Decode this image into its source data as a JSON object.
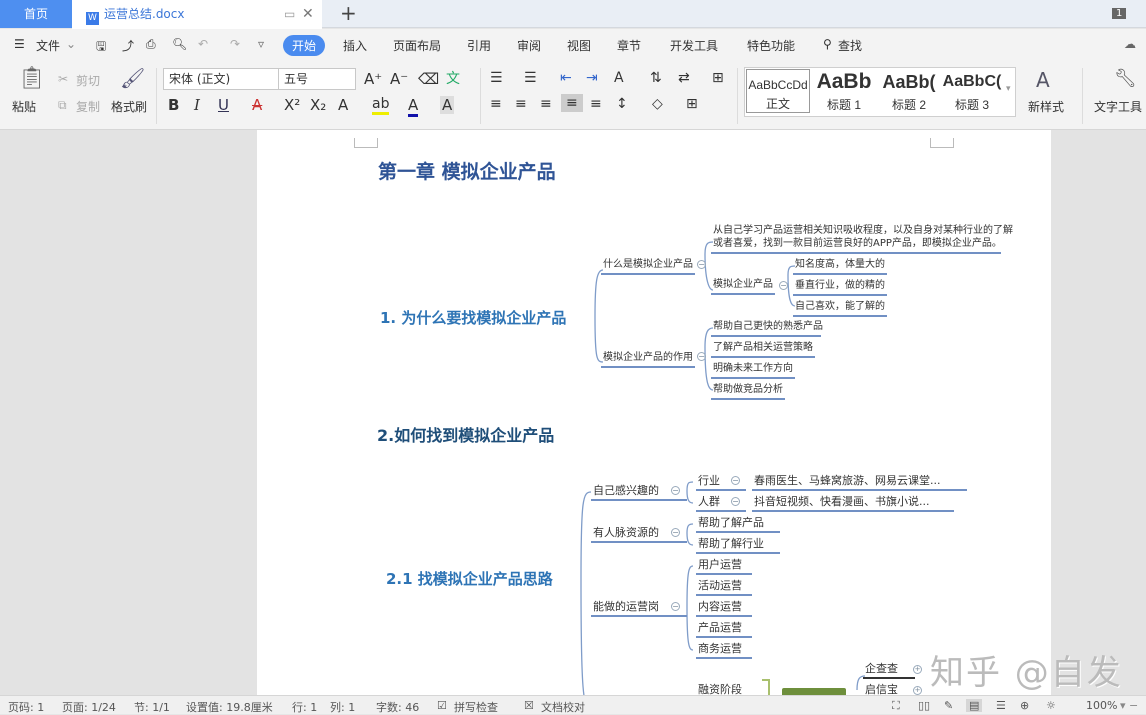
{
  "tabs": {
    "home": "首页",
    "doc": "运营总结.docx",
    "new": "+",
    "badge": "1"
  },
  "menu": {
    "file": "文件",
    "items": [
      "开始",
      "插入",
      "页面布局",
      "引用",
      "审阅",
      "视图",
      "章节",
      "开发工具",
      "特色功能"
    ],
    "search": "查找"
  },
  "toolbar": {
    "paste": "粘贴",
    "cut": "剪切",
    "copy": "复制",
    "format_painter": "格式刷",
    "font": "宋体 (正文)",
    "size": "五号",
    "styles": [
      {
        "preview": "AaBbCcDd",
        "label": "正文"
      },
      {
        "preview": "AaBb",
        "label": "标题 1"
      },
      {
        "preview": "AaBb(",
        "label": "标题 2"
      },
      {
        "preview": "AaBbC(",
        "label": "标题 3"
      }
    ],
    "new_style": "新样式",
    "text_tools": "文字工具"
  },
  "doc": {
    "chapter": "第一章  模拟企业产品",
    "s1": "1. 为什么要找模拟企业产品",
    "m1": {
      "b1": "什么是模拟企业产品",
      "b1_desc1": "从自己学习产品运营相关知识吸收程度，以及自身对某种行业的了解",
      "b1_desc2": "或者喜爱，找到一款目前运营良好的APP产品，即模拟企业产品。",
      "b1_sub": "模拟企业产品",
      "b1_sub_items": [
        "知名度高，体量大的",
        "垂直行业，做的精的",
        "自己喜欢，能了解的"
      ],
      "b2": "模拟企业产品的作用",
      "b2_items": [
        "帮助自己更快的熟悉产品",
        "了解产品相关运营策略",
        "明确未来工作方向",
        "帮助做竞品分析"
      ]
    },
    "s2": "2.如何找到模拟企业产品",
    "s21": "2.1 找模拟企业产品思路",
    "m2": {
      "b1": "自己感兴趣的",
      "b1_items": [
        {
          "k": "行业",
          "v": "春雨医生、马蜂窝旅游、网易云课堂..."
        },
        {
          "k": "人群",
          "v": "抖音短视频、快看漫画、书旗小说..."
        }
      ],
      "b2": "有人脉资源的",
      "b2_items": [
        "帮助了解产品",
        "帮助了解行业"
      ],
      "b3": "能做的运营岗",
      "b3_items": [
        "用户运营",
        "活动运营",
        "内容运营",
        "产品运营",
        "商务运营"
      ],
      "b4_item": "融资阶段",
      "b4_tools": [
        "企查查",
        "启信宝"
      ]
    }
  },
  "watermark": "知乎 @自发",
  "status": {
    "page_num": "页码: 1",
    "pages": "页面: 1/24",
    "section": "节: 1/1",
    "setting": "设置值: 19.8厘米",
    "row": "行: 1",
    "col": "列: 1",
    "words": "字数: 46",
    "spell": "拼写检查",
    "proof": "文档校对",
    "zoom": "100%"
  }
}
